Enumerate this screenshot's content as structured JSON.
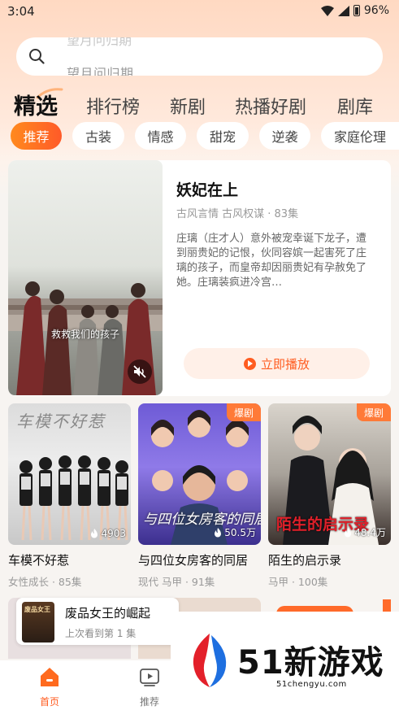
{
  "status_bar": {
    "time": "3:04",
    "battery": "96%"
  },
  "search": {
    "placeholder": "望月问归期",
    "previous_placeholder": "望月问归期"
  },
  "main_nav": [
    {
      "label": "精选",
      "active": true
    },
    {
      "label": "排行榜"
    },
    {
      "label": "新剧"
    },
    {
      "label": "热播好剧"
    },
    {
      "label": "剧库"
    }
  ],
  "chips": [
    {
      "label": "推荐",
      "active": true
    },
    {
      "label": "古装"
    },
    {
      "label": "情感"
    },
    {
      "label": "甜宠"
    },
    {
      "label": "逆袭"
    },
    {
      "label": "家庭伦理"
    }
  ],
  "featured": {
    "title": "妖妃在上",
    "meta": "古风言情 古风权谋 · 83集",
    "description": "庄璃（庄才人）意外被宠幸诞下龙子，遭到丽贵妃的记恨，伙同容嫔一起害死了庄璃的孩子，而皇帝却因丽贵妃有孕赦免了她。庄璃装疯进冷宫…",
    "caption": "救救我们的孩子",
    "play_label": "立即播放"
  },
  "grid": [
    {
      "title": "车模不好惹",
      "meta": "女性成长 · 85集",
      "heat": "4903",
      "badge": "",
      "poster_text": "车模不好惹"
    },
    {
      "title": "与四位女房客的同居",
      "meta": "现代 马甲 · 91集",
      "heat": "50.5万",
      "badge": "爆剧",
      "poster_text": "与四位女房客的同居"
    },
    {
      "title": "陌生的启示录",
      "meta": "马甲 · 100集",
      "heat": "48.4万",
      "badge": "爆剧",
      "poster_text": "陌生的启示录"
    }
  ],
  "continue_watching": {
    "title": "废品女王的崛起",
    "subtitle": "上次看到第 1 集",
    "thumb_text": "废品女王"
  },
  "tabs": [
    {
      "label": "首页",
      "icon": "home-icon",
      "active": true
    },
    {
      "label": "推荐",
      "icon": "video-icon"
    }
  ],
  "watermark": {
    "brand": "51新游戏",
    "domain": "51chengyu.com"
  },
  "colors": {
    "accent": "#ff5c20",
    "badge": "#ff7a38"
  }
}
